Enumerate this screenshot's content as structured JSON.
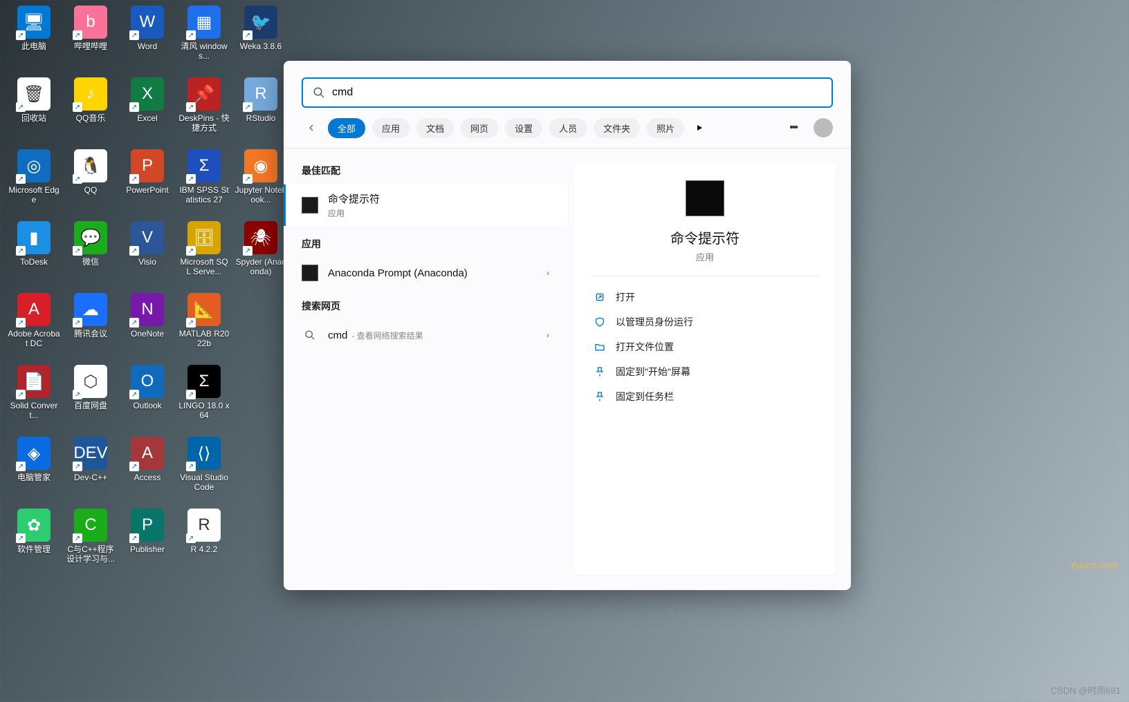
{
  "desktop_icons_col1": [
    {
      "label": "此电脑",
      "bg": "#0078d4",
      "sym": "🖥"
    },
    {
      "label": "回收站",
      "bg": "#ffffff",
      "sym": "🗑"
    },
    {
      "label": "Microsoft Edge",
      "bg": "#0f6dbf",
      "sym": "◎"
    },
    {
      "label": "ToDesk",
      "bg": "#1a8fe3",
      "sym": "▮"
    },
    {
      "label": "Adobe Acrobat DC",
      "bg": "#d61f26",
      "sym": "A"
    },
    {
      "label": "Solid Convert...",
      "bg": "#b0252a",
      "sym": "📄"
    },
    {
      "label": "电脑管家",
      "bg": "#0a6be0",
      "sym": "◈"
    },
    {
      "label": "软件管理",
      "bg": "#2ecc71",
      "sym": "✿"
    }
  ],
  "desktop_icons_col2": [
    {
      "label": "哔哩哔哩",
      "bg": "#fb7299",
      "sym": "b"
    },
    {
      "label": "QQ音乐",
      "bg": "#ffd400",
      "sym": "♪"
    },
    {
      "label": "QQ",
      "bg": "#fff",
      "sym": "🐧"
    },
    {
      "label": "微信",
      "bg": "#1aad19",
      "sym": "💬"
    },
    {
      "label": "腾讯会议",
      "bg": "#1a6fff",
      "sym": "☁"
    },
    {
      "label": "百度网盘",
      "bg": "#fff",
      "sym": "⬡"
    },
    {
      "label": "Dev-C++",
      "bg": "#1e5799",
      "sym": "DEV"
    },
    {
      "label": "C与C++程序设计学习与...",
      "bg": "#1aad19",
      "sym": "C"
    }
  ],
  "desktop_icons_col3": [
    {
      "label": "Word",
      "bg": "#185abd",
      "sym": "W"
    },
    {
      "label": "Excel",
      "bg": "#107c41",
      "sym": "X"
    },
    {
      "label": "PowerPoint",
      "bg": "#d24726",
      "sym": "P"
    },
    {
      "label": "Visio",
      "bg": "#2b579a",
      "sym": "V"
    },
    {
      "label": "OneNote",
      "bg": "#7719aa",
      "sym": "N"
    },
    {
      "label": "Outlook",
      "bg": "#0f6cbd",
      "sym": "O"
    },
    {
      "label": "Access",
      "bg": "#a4373a",
      "sym": "A"
    },
    {
      "label": "Publisher",
      "bg": "#077568",
      "sym": "P"
    }
  ],
  "desktop_icons_col4": [
    {
      "label": "清风 windows...",
      "bg": "#1f6feb",
      "sym": "▦"
    },
    {
      "label": "DeskPins - 快捷方式",
      "bg": "#b22",
      "sym": "📌"
    },
    {
      "label": "IBM SPSS Statistics 27",
      "bg": "#1f4fbf",
      "sym": "Σ"
    },
    {
      "label": "Microsoft SQL Serve...",
      "bg": "#d9a400",
      "sym": "🗄"
    },
    {
      "label": "MATLAB R2022b",
      "bg": "#e25d1f",
      "sym": "📐"
    },
    {
      "label": "LINGO 18.0 x64",
      "bg": "#000",
      "sym": "Σ"
    },
    {
      "label": "Visual Studio Code",
      "bg": "#0065a9",
      "sym": "⟨⟩"
    },
    {
      "label": "R 4.2.2",
      "bg": "#fff",
      "sym": "R"
    }
  ],
  "desktop_icons_col5": [
    {
      "label": "Weka 3.8.6",
      "bg": "#1a3b6e",
      "sym": "🐦"
    },
    {
      "label": "RStudio",
      "bg": "#75aadb",
      "sym": "R"
    },
    {
      "label": "Jupyter Notebook...",
      "bg": "#f37626",
      "sym": "◉"
    },
    {
      "label": "Spyder (Anaconda)",
      "bg": "#8c0000",
      "sym": "🕷"
    }
  ],
  "search": {
    "query": "cmd",
    "tabs": [
      "全部",
      "应用",
      "文档",
      "网页",
      "设置",
      "人员",
      "文件夹",
      "照片"
    ],
    "active_tab": 0,
    "sections": {
      "best": "最佳匹配",
      "apps": "应用",
      "web": "搜索网页"
    },
    "best": {
      "title": "命令提示符",
      "sub": "应用"
    },
    "apps": [
      {
        "title": "Anaconda Prompt (Anaconda)"
      }
    ],
    "web": {
      "query": "cmd",
      "hint": "- 查看网络搜索结果"
    }
  },
  "preview": {
    "title": "命令提示符",
    "sub": "应用",
    "actions": [
      {
        "icon": "open",
        "label": "打开"
      },
      {
        "icon": "shield",
        "label": "以管理员身份运行"
      },
      {
        "icon": "folder",
        "label": "打开文件位置"
      },
      {
        "icon": "pin",
        "label": "固定到\"开始\"屏幕"
      },
      {
        "icon": "pin",
        "label": "固定到任务栏"
      }
    ]
  },
  "watermarks": {
    "csdn": "CSDN @时雨691",
    "yucn": "Yuucn.com"
  }
}
